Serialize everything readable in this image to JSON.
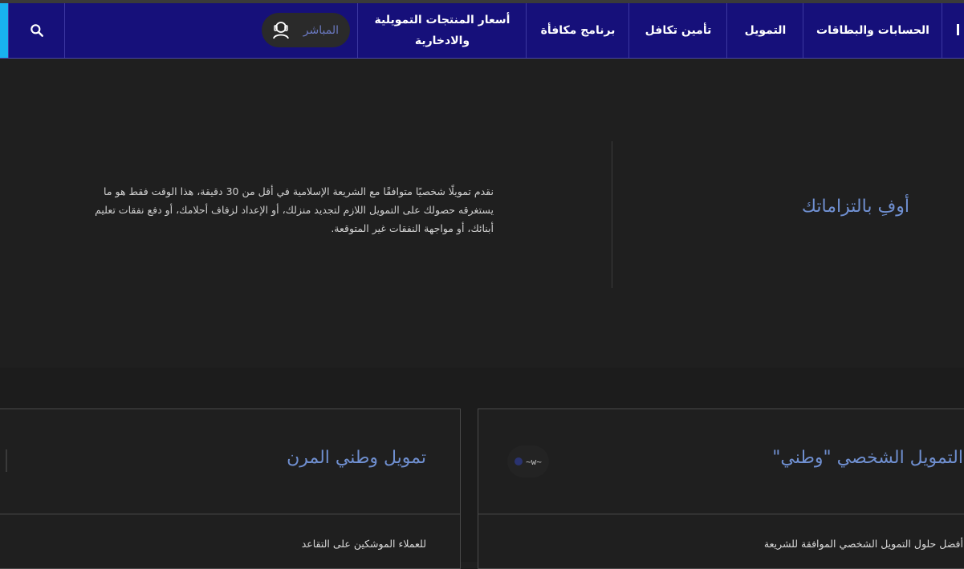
{
  "nav": {
    "items": [
      {
        "label": "الحسابات والبطاقات"
      },
      {
        "label": "التمويل"
      },
      {
        "label": "تأمين تكافل"
      },
      {
        "label": "برنامج مكافأة"
      },
      {
        "label": "أسعار المنتجات التمويلية والادخارية"
      }
    ],
    "live_label": "المباشر",
    "colors": {
      "bar": "#16107a",
      "accent": "#18b2f0"
    }
  },
  "hero": {
    "title": "أوفِ بالتزاماتك",
    "text": "نقدم تمويلًا شخصيًا متوافقًا مع الشريعة الإسلامية في أقل من 30 دقيقة، هذا الوقت فقط هو ما يستغرقه حصولك على التمويل اللازم لتجديد منزلك، أو الإعداد لزفاف أحلامك، أو دفع نفقات تعليم أبنائك، أو مواجهة النفقات غير المتوقعة."
  },
  "cards": [
    {
      "title": "التمويل الشخصي \"وطني\"",
      "desc": "أفضل حلول التمويل الشخصي الموافقة للشريعة"
    },
    {
      "title": "تمويل وطني المرن",
      "desc": "للعملاء الموشكين على التقاعد"
    }
  ],
  "icons": {
    "search": "search-icon",
    "live": "headset-person-icon",
    "card_badge": "squiggle-icon"
  }
}
